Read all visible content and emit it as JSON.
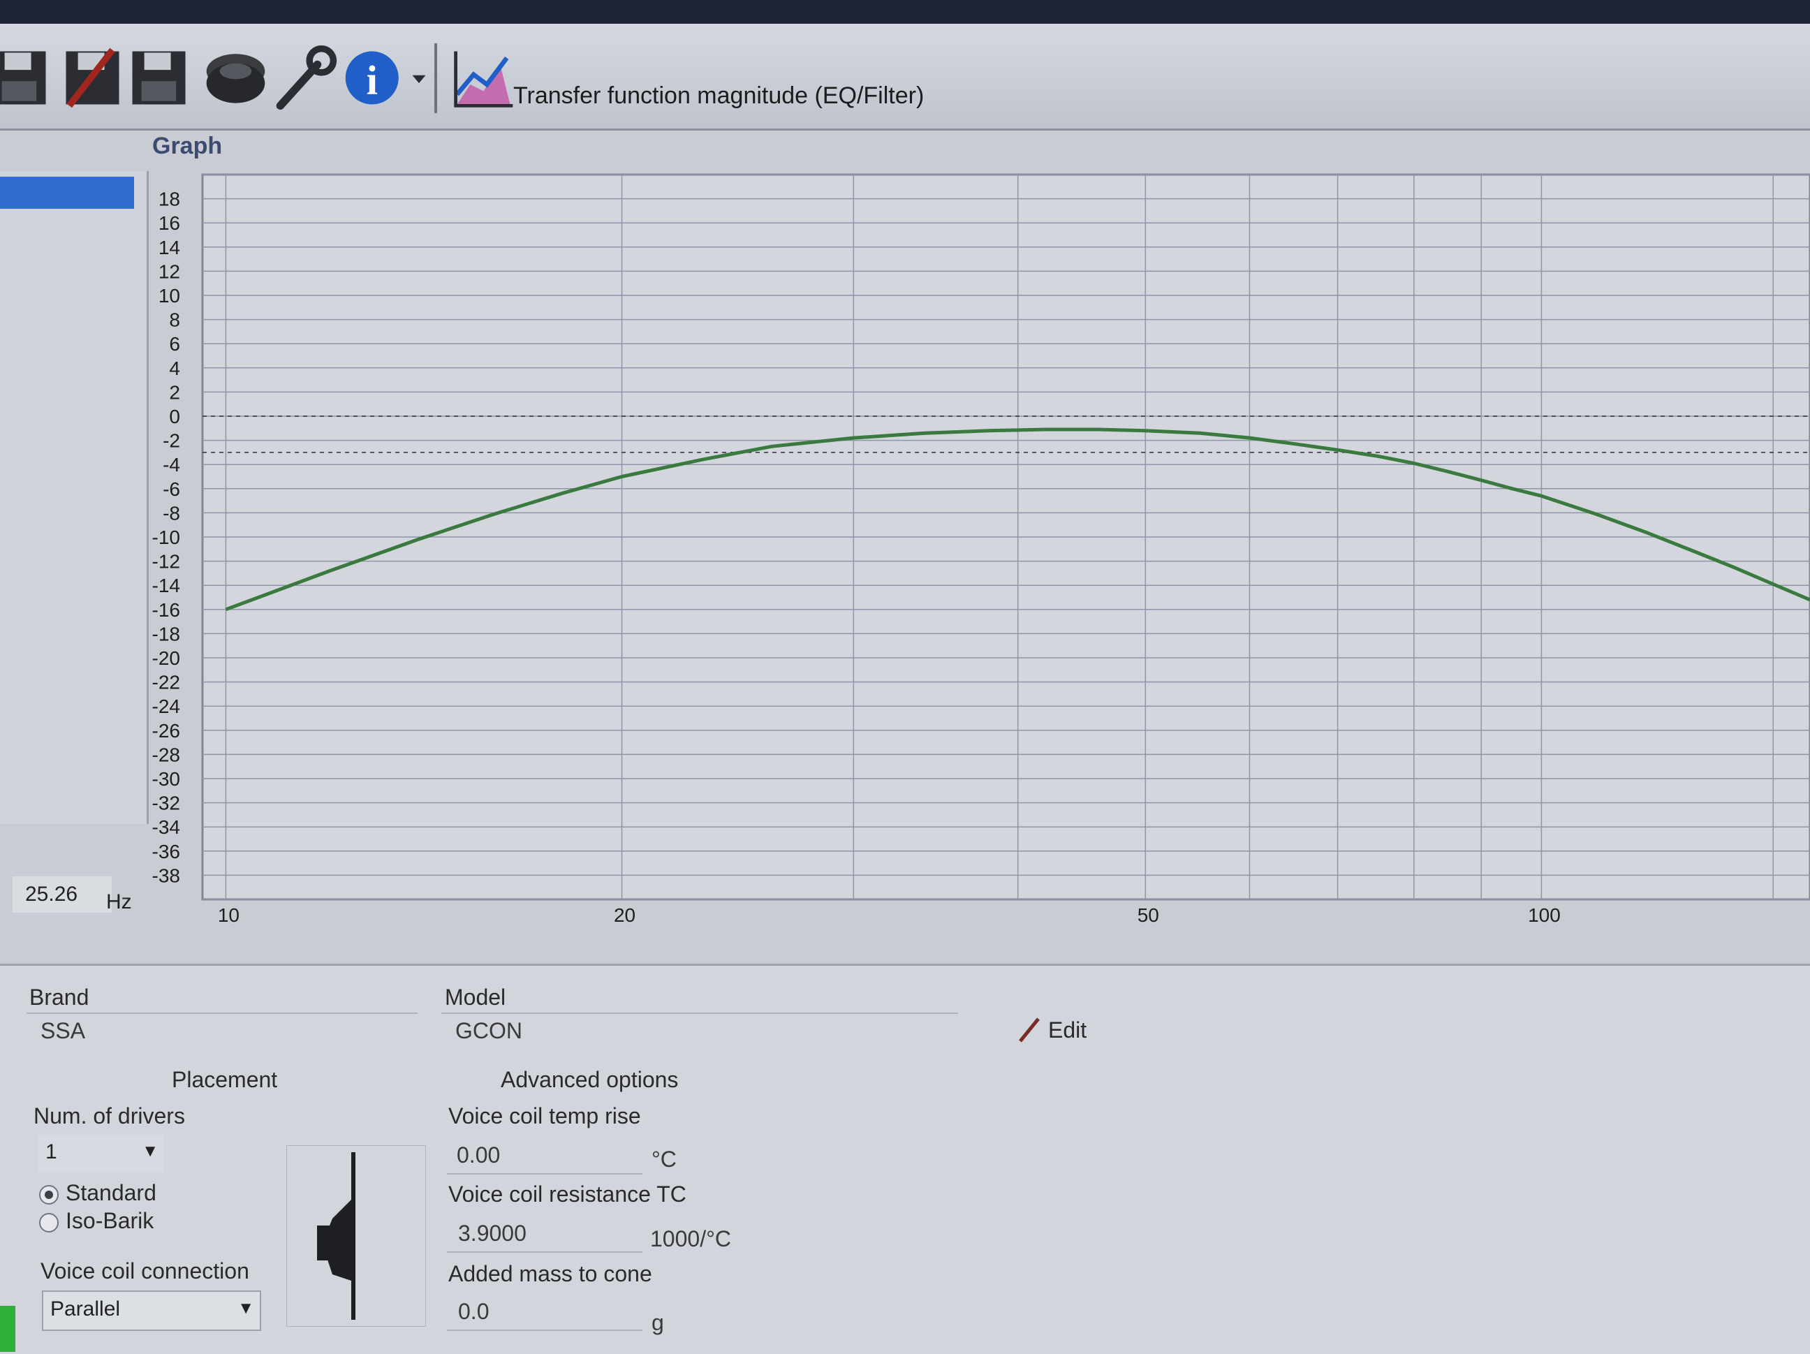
{
  "toolbar": {
    "title": "Transfer function magnitude (EQ/Filter)",
    "icons": [
      "save-icon",
      "save-as-icon",
      "save-all-icon",
      "speaker-icon",
      "wrench-icon",
      "info-icon",
      "dropdown-arrow-icon",
      "chart-icon"
    ]
  },
  "graph_panel": {
    "label": "Graph",
    "freq_value": "25.26",
    "freq_unit": "Hz"
  },
  "chart_data": {
    "type": "line",
    "xlabel": "",
    "ylabel": "",
    "x_scale": "log",
    "xlim": [
      9.6,
      160
    ],
    "ylim": [
      -40,
      20
    ],
    "y_ticks": [
      18,
      16,
      14,
      12,
      10,
      8,
      6,
      4,
      2,
      0,
      -2,
      -4,
      -6,
      -8,
      -10,
      -12,
      -14,
      -16,
      -18,
      -20,
      -22,
      -24,
      -26,
      -28,
      -30,
      -32,
      -34,
      -36,
      -38
    ],
    "x_tick_labels": [
      "10",
      "20",
      "50",
      "100"
    ],
    "x_tick_values": [
      10,
      20,
      50,
      100
    ],
    "reference_lines": [
      0,
      -3
    ],
    "grid": true,
    "series": [
      {
        "color": "#3b7a3f",
        "x": [
          10,
          12,
          14,
          16,
          18,
          20,
          23,
          26,
          30,
          34,
          38,
          42,
          46,
          50,
          55,
          60,
          65,
          70,
          75,
          80,
          85,
          90,
          95,
          100,
          110,
          120,
          130,
          140,
          150,
          160
        ],
        "y": [
          -16,
          -12.8,
          -10.2,
          -8.1,
          -6.4,
          -5,
          -3.6,
          -2.5,
          -1.8,
          -1.4,
          -1.2,
          -1.1,
          -1.1,
          -1.2,
          -1.4,
          -1.8,
          -2.3,
          -2.8,
          -3.3,
          -3.9,
          -4.6,
          -5.3,
          -6,
          -6.6,
          -8.1,
          -9.6,
          -11.1,
          -12.5,
          -13.9,
          -15.2
        ]
      }
    ],
    "colors": {
      "grid": "#8d96a8",
      "background": "#d3d7dd",
      "curve": "#3b7a3f"
    }
  },
  "params": {
    "brand_label": "Brand",
    "brand_value": "SSA",
    "model_label": "Model",
    "model_value": "GCON",
    "edit_label": "Edit",
    "placement_title": "Placement",
    "num_drivers_label": "Num. of drivers",
    "num_drivers_value": "1",
    "radio_standard": "Standard",
    "radio_isobarik": "Iso-Barik",
    "radio_selected": "Standard",
    "vc_connection_label": "Voice coil connection",
    "vc_connection_value": "Parallel",
    "advanced_title": "Advanced options",
    "vc_temp_label": "Voice coil temp rise",
    "vc_temp_value": "0.00",
    "vc_temp_unit": "°C",
    "vc_res_label": "Voice coil resistance TC",
    "vc_res_value": "3.9000",
    "vc_res_unit": "1000/°C",
    "mass_label": "Added mass to cone",
    "mass_value": "0.0",
    "mass_unit": "g"
  }
}
